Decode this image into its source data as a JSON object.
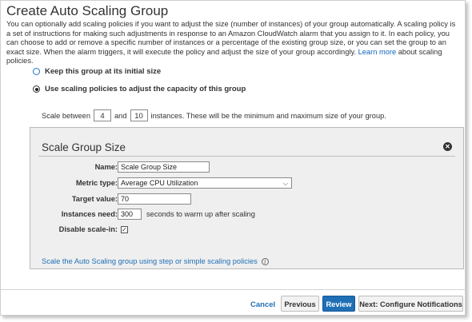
{
  "page": {
    "title": "Create Auto Scaling Group",
    "description": "You can optionally add scaling policies if you want to adjust the size (number of instances) of your group automatically. A scaling policy is a set of instructions for making such adjustments in response to an Amazon CloudWatch alarm that you assign to it. In each policy, you can choose to add or remove a specific number of instances or a percentage of the existing group size, or you can set the group to an exact size. When the alarm triggers, it will execute the policy and adjust the size of your group accordingly.",
    "learn_more_link": "Learn more",
    "learn_more_suffix": "about scaling policies."
  },
  "options": {
    "keep_initial": "Keep this group at its initial size",
    "use_policies": "Use scaling policies to adjust the capacity of this group"
  },
  "scale": {
    "prefix": "Scale between",
    "min": "4",
    "and": "and",
    "max": "10",
    "suffix": "instances. These will be the minimum and maximum size of your group."
  },
  "panel": {
    "title": "Scale Group Size",
    "name_label": "Name:",
    "name_value": "Scale Group Size",
    "metric_label": "Metric type:",
    "metric_value": "Average CPU Utilization",
    "target_label": "Target value:",
    "target_value": "70",
    "instances_label": "Instances need:",
    "instances_value": "300",
    "instances_suffix": "seconds to warm up after scaling",
    "disable_label": "Disable scale-in:",
    "disable_checked": true,
    "step_link": "Scale the Auto Scaling group using step or simple scaling policies"
  },
  "footer": {
    "cancel": "Cancel",
    "previous": "Previous",
    "review": "Review",
    "next": "Next: Configure Notifications"
  },
  "colors": {
    "link": "#1f6fb5",
    "primary_button": "#1f6fb5",
    "panel_bg": "#efefef"
  }
}
